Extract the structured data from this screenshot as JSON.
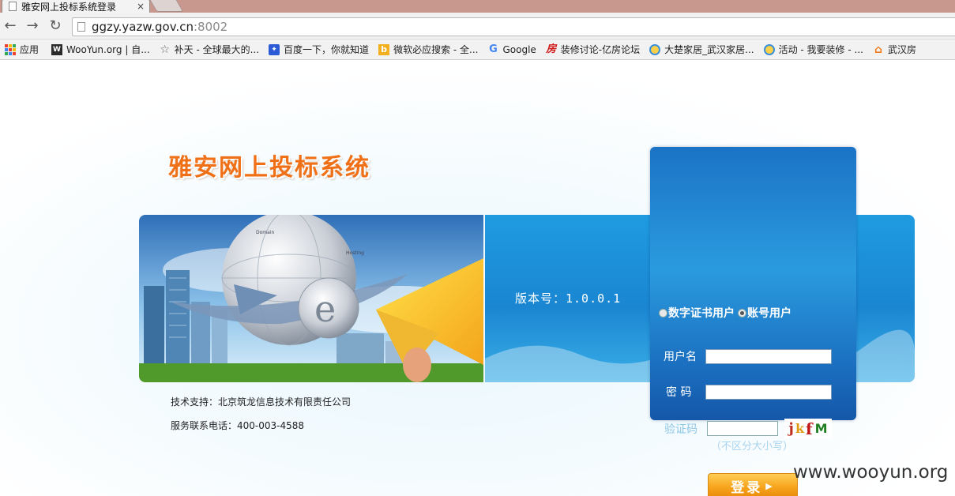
{
  "browser": {
    "tab_title": "雅安网上投标系统登录",
    "tab_close": "×",
    "url_host": "ggzy.yazw.gov.cn",
    "url_port": ":8002",
    "back_icon": "arrow-left-icon",
    "forward_icon": "arrow-right-icon",
    "reload_icon": "reload-icon",
    "bookmarks": [
      {
        "label": "应用",
        "icon": "apps-grid-icon"
      },
      {
        "label": "WooYun.org | 自...",
        "icon": "wooyun-icon",
        "color": "#2b2b2b"
      },
      {
        "label": "补天 - 全球最大的...",
        "icon": "star-icon",
        "color": "#666666"
      },
      {
        "label": "百度一下，你就知道",
        "icon": "baidu-paw-icon",
        "color": "#2c5ad6"
      },
      {
        "label": "微软必应搜索 - 全...",
        "icon": "bing-icon",
        "color": "#f2b01e"
      },
      {
        "label": "Google",
        "icon": "google-g-icon",
        "color": "#4285f4"
      },
      {
        "label": "装修讨论-亿房论坛",
        "icon": "fang-icon",
        "color": "#d01818"
      },
      {
        "label": "大楚家居_武汉家居...",
        "icon": "globe-icon",
        "color": "#3a8fd8"
      },
      {
        "label": "活动 - 我要装修 - ...",
        "icon": "globe-icon",
        "color": "#3a8fd8"
      },
      {
        "label": "武汉房",
        "icon": "house-icon",
        "color": "#f07a1a"
      }
    ]
  },
  "page": {
    "site_title": "雅安网上投标系统",
    "version": "版本号：1.0.0.1",
    "banner_text_domain": "Domain",
    "banner_text_hosting": "Hosting",
    "login": {
      "radio_cert": "数字证书用户",
      "radio_account": "账号用户",
      "username_label": "用户名",
      "password_label": "密 码",
      "captcha_label": "验证码",
      "captcha_chars": [
        "j",
        "k",
        "f",
        "M"
      ],
      "captcha_hint": "（不区分大小写）",
      "submit_label": "登录",
      "username_value": "",
      "password_value": "",
      "captcha_value": ""
    },
    "support_text": "技术支持：北京筑龙信息技术有限责任公司",
    "hotline_text": "服务联系电话：400-003-4588"
  },
  "watermark": "www.wooyun.org",
  "colors": {
    "title_orange": "#f07018",
    "panel_blue": "#1b73c6",
    "button_orange": "#f7a51e"
  }
}
